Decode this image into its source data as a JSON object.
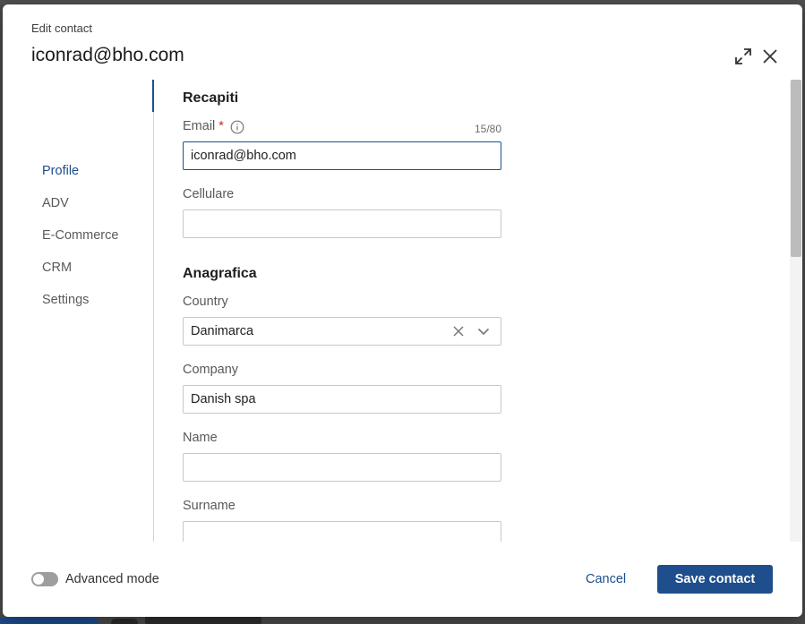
{
  "header": {
    "eyebrow": "Edit contact",
    "title": "iconrad@bho.com"
  },
  "sidenav": {
    "items": [
      {
        "label": "Profile",
        "active": true
      },
      {
        "label": "ADV",
        "active": false
      },
      {
        "label": "E-Commerce",
        "active": false
      },
      {
        "label": "CRM",
        "active": false
      },
      {
        "label": "Settings",
        "active": false
      }
    ]
  },
  "form": {
    "recapiti_title": "Recapiti",
    "email": {
      "label": "Email",
      "required_mark": "*",
      "value": "iconrad@bho.com",
      "counter": "15/80"
    },
    "cellulare": {
      "label": "Cellulare",
      "value": ""
    },
    "anagrafica_title": "Anagrafica",
    "country": {
      "label": "Country",
      "value": "Danimarca"
    },
    "company": {
      "label": "Company",
      "value": "Danish spa"
    },
    "name": {
      "label": "Name",
      "value": ""
    },
    "surname": {
      "label": "Surname",
      "value": ""
    }
  },
  "footer": {
    "advanced_mode_label": "Advanced mode",
    "advanced_mode_on": false,
    "cancel_label": "Cancel",
    "save_label": "Save contact"
  },
  "colors": {
    "accent": "#1e4e8c",
    "required": "#c62828"
  }
}
